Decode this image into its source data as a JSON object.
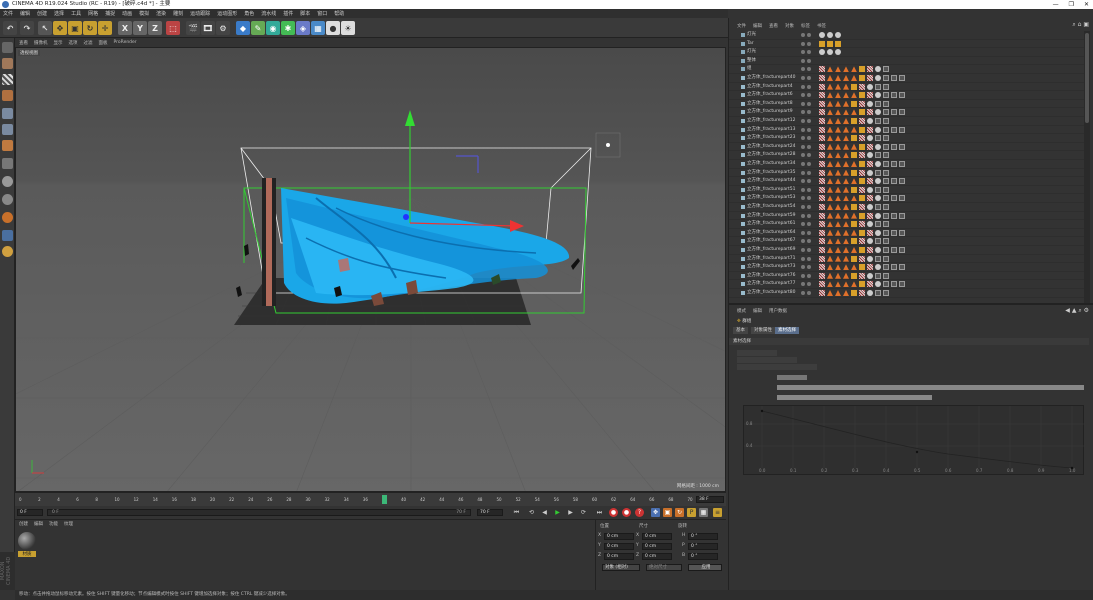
{
  "title": "CINEMA 4D R19.024 Studio (RC - R19) - [破碎.c4d *] - 主要",
  "winbtns": [
    "—",
    "❐",
    "✕"
  ],
  "menu": [
    "文件",
    "编辑",
    "创建",
    "选择",
    "工具",
    "网格",
    "捕捉",
    "动画",
    "模拟",
    "渲染",
    "雕刻",
    "运动跟踪",
    "运动图形",
    "角色",
    "流水线",
    "插件",
    "脚本",
    "窗口",
    "帮助"
  ],
  "vpmenu": [
    "查看",
    "摄像机",
    "显示",
    "选项",
    "过滤",
    "面板",
    "ProRender"
  ],
  "vp_label": "透视视图",
  "grid_info": "网格间距 : 1000 cm",
  "timeline_ticks": [
    "0",
    "2",
    "4",
    "6",
    "8",
    "10",
    "12",
    "14",
    "16",
    "18",
    "20",
    "22",
    "24",
    "26",
    "28",
    "30",
    "32",
    "34",
    "36",
    "38",
    "40",
    "42",
    "44",
    "46",
    "48",
    "50",
    "52",
    "54",
    "56",
    "58",
    "60",
    "62",
    "64",
    "66",
    "68",
    "70"
  ],
  "timeline_end": "38 F",
  "transport": {
    "start": "0 F",
    "cur": "0 F",
    "end": "70 F",
    "max": "70 F"
  },
  "mat_menu": [
    "创建",
    "编辑",
    "功能",
    "纹理"
  ],
  "mat_name": "材质",
  "coord": {
    "headers": [
      "位置",
      "尺寸",
      "旋转"
    ],
    "rows": [
      [
        "X",
        "0 cm",
        "X",
        "0 cm",
        "H",
        "0 °"
      ],
      [
        "Y",
        "0 cm",
        "Y",
        "0 cm",
        "P",
        "0 °"
      ],
      [
        "Z",
        "0 cm",
        "Z",
        "0 cm",
        "B",
        "0 °"
      ]
    ],
    "mode": "对象 (相对)",
    "size_mode": "绝对尺寸",
    "apply": "应用"
  },
  "status": "移动：点击并拖动鼠标移动元素。按住 SHIFT 键量化移动；节点编辑模式时按住 SHIFT 键增加选择对象；按住 CTRL 键减少选择对象。",
  "c4d_side": "MAXON CINEMA 4D",
  "obj_menu": [
    "文件",
    "编辑",
    "查看",
    "对象",
    "标签",
    "书签"
  ],
  "top_objects": [
    {
      "name": "灯光",
      "tags": "c"
    },
    {
      "name": "Tar",
      "tags": "y"
    },
    {
      "name": "灯光",
      "tags": "c"
    },
    {
      "name": "整体",
      "tags": ""
    },
    {
      "name": "组",
      "tags": "x"
    }
  ],
  "objects": [
    "立方体_fracturepart40",
    "立方体_fracturepart4",
    "立方体_fracturepart6",
    "立方体_fracturepart8",
    "立方体_fracturepart9",
    "立方体_fracturepart12",
    "立方体_fracturepart13",
    "立方体_fracturepart23",
    "立方体_fracturepart24",
    "立方体_fracturepart28",
    "立方体_fracturepart34",
    "立方体_fracturepart35",
    "立方体_fracturepart44",
    "立方体_fracturepart51",
    "立方体_fracturepart53",
    "立方体_fracturepart54",
    "立方体_fracturepart59",
    "立方体_fracturepart61",
    "立方体_fracturepart64",
    "立方体_fracturepart67",
    "立方体_fracturepart69",
    "立方体_fracturepart71",
    "立方体_fracturepart73",
    "立方体_fracturepart76",
    "立方体_fracturepart77",
    "立方体_fracturepart80"
  ],
  "attr_menu": [
    "模式",
    "编辑",
    "用户数据"
  ],
  "attr_title": "群组",
  "attr_tabs": [
    "基本",
    "对象属性",
    "素材选择"
  ],
  "attr_section": "素材选择",
  "graph_x": [
    "0.0",
    "0.1",
    "0.2",
    "0.3",
    "0.4",
    "0.5",
    "0.6",
    "0.7",
    "0.8",
    "0.9",
    "1.0"
  ],
  "graph_y": [
    "0.8",
    "0.4"
  ]
}
